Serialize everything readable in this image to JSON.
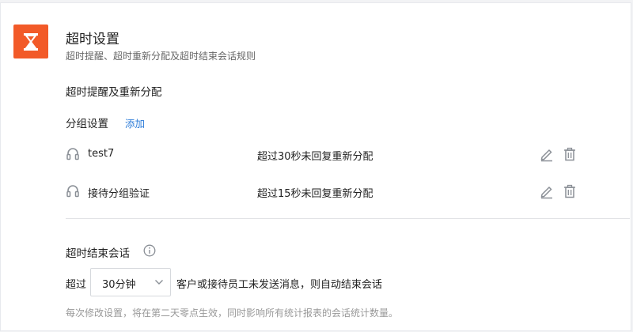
{
  "header": {
    "title": "超时设置",
    "subtitle": "超时提醒、超时重新分配及超时结束会话规则",
    "icon": "hourglass-icon",
    "accent_color": "#f25a28"
  },
  "reassign_section": {
    "title": "超时提醒及重新分配",
    "group_settings_label": "分组设置",
    "add_link": "添加",
    "rows": [
      {
        "name": "test7",
        "rule": "超过30秒未回复重新分配"
      },
      {
        "name": "接待分组验证",
        "rule": "超过15秒未回复重新分配"
      }
    ]
  },
  "end_session_section": {
    "title": "超时结束会话",
    "exceed_label": "超过",
    "selected_duration": "30分钟",
    "after_text": "客户或接待员工未发送消息，则自动结束会话",
    "note": "每次修改设置，将在第二天零点生效，同时影响所有统计报表的会话统计数量。"
  },
  "colors": {
    "link": "#2b7bd8",
    "icon_gray": "#8a8f96",
    "muted_text": "#999999"
  }
}
